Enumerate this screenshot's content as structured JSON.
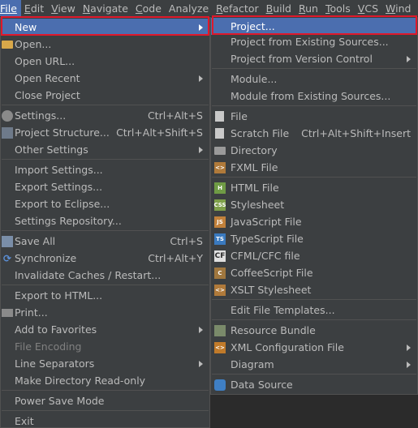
{
  "menubar": {
    "items": [
      {
        "label": "File",
        "mnemonic_index": 0
      },
      {
        "label": "Edit",
        "mnemonic_index": 0
      },
      {
        "label": "View",
        "mnemonic_index": 0
      },
      {
        "label": "Navigate",
        "mnemonic_index": 0
      },
      {
        "label": "Code",
        "mnemonic_index": 0
      },
      {
        "label": "Analyze",
        "mnemonic_index": -1
      },
      {
        "label": "Refactor",
        "mnemonic_index": 0
      },
      {
        "label": "Build",
        "mnemonic_index": 0
      },
      {
        "label": "Run",
        "mnemonic_index": 0
      },
      {
        "label": "Tools",
        "mnemonic_index": 0
      },
      {
        "label": "VCS",
        "mnemonic_index": 0
      },
      {
        "label": "Wind",
        "mnemonic_index": 0
      }
    ]
  },
  "file_menu": {
    "new": "New",
    "open": "Open...",
    "open_url": "Open URL...",
    "open_recent": "Open Recent",
    "close_project": "Close Project",
    "settings": "Settings...",
    "settings_sc": "Ctrl+Alt+S",
    "project_structure": "Project Structure...",
    "project_structure_sc": "Ctrl+Alt+Shift+S",
    "other_settings": "Other Settings",
    "import_settings": "Import Settings...",
    "export_settings": "Export Settings...",
    "export_eclipse": "Export to Eclipse...",
    "settings_repo": "Settings Repository...",
    "save_all": "Save All",
    "save_all_sc": "Ctrl+S",
    "synchronize": "Synchronize",
    "synchronize_sc": "Ctrl+Alt+Y",
    "invalidate": "Invalidate Caches / Restart...",
    "export_html": "Export to HTML...",
    "print": "Print...",
    "add_favorites": "Add to Favorites",
    "file_encoding": "File Encoding",
    "line_separators": "Line Separators",
    "make_readonly": "Make Directory Read-only",
    "power_save": "Power Save Mode",
    "exit": "Exit"
  },
  "new_menu": {
    "project": "Project...",
    "project_existing": "Project from Existing Sources...",
    "project_vcs": "Project from Version Control",
    "module": "Module...",
    "module_existing": "Module from Existing Sources...",
    "file": "File",
    "scratch": "Scratch File",
    "scratch_sc": "Ctrl+Alt+Shift+Insert",
    "directory": "Directory",
    "fxml": "FXML File",
    "html": "HTML File",
    "stylesheet": "Stylesheet",
    "javascript": "JavaScript File",
    "typescript": "TypeScript File",
    "cfml": "CFML/CFC file",
    "coffeescript": "CoffeeScript File",
    "xslt": "XSLT Stylesheet",
    "edit_templates": "Edit File Templates...",
    "resource_bundle": "Resource Bundle",
    "xml_config": "XML Configuration File",
    "diagram": "Diagram",
    "data_source": "Data Source"
  },
  "icon_glyphs": {
    "html": "H",
    "css": "CSS",
    "js": "JS",
    "ts": "TS",
    "cf": "CF",
    "coffee": "C",
    "xslt": "<>",
    "xml": "<>",
    "fxml": "<>"
  },
  "colors": {
    "selection": "#4b6eaf",
    "highlight_box": "#e0182b",
    "menu_bg": "#3c3f41",
    "text": "#bbbbbb"
  }
}
